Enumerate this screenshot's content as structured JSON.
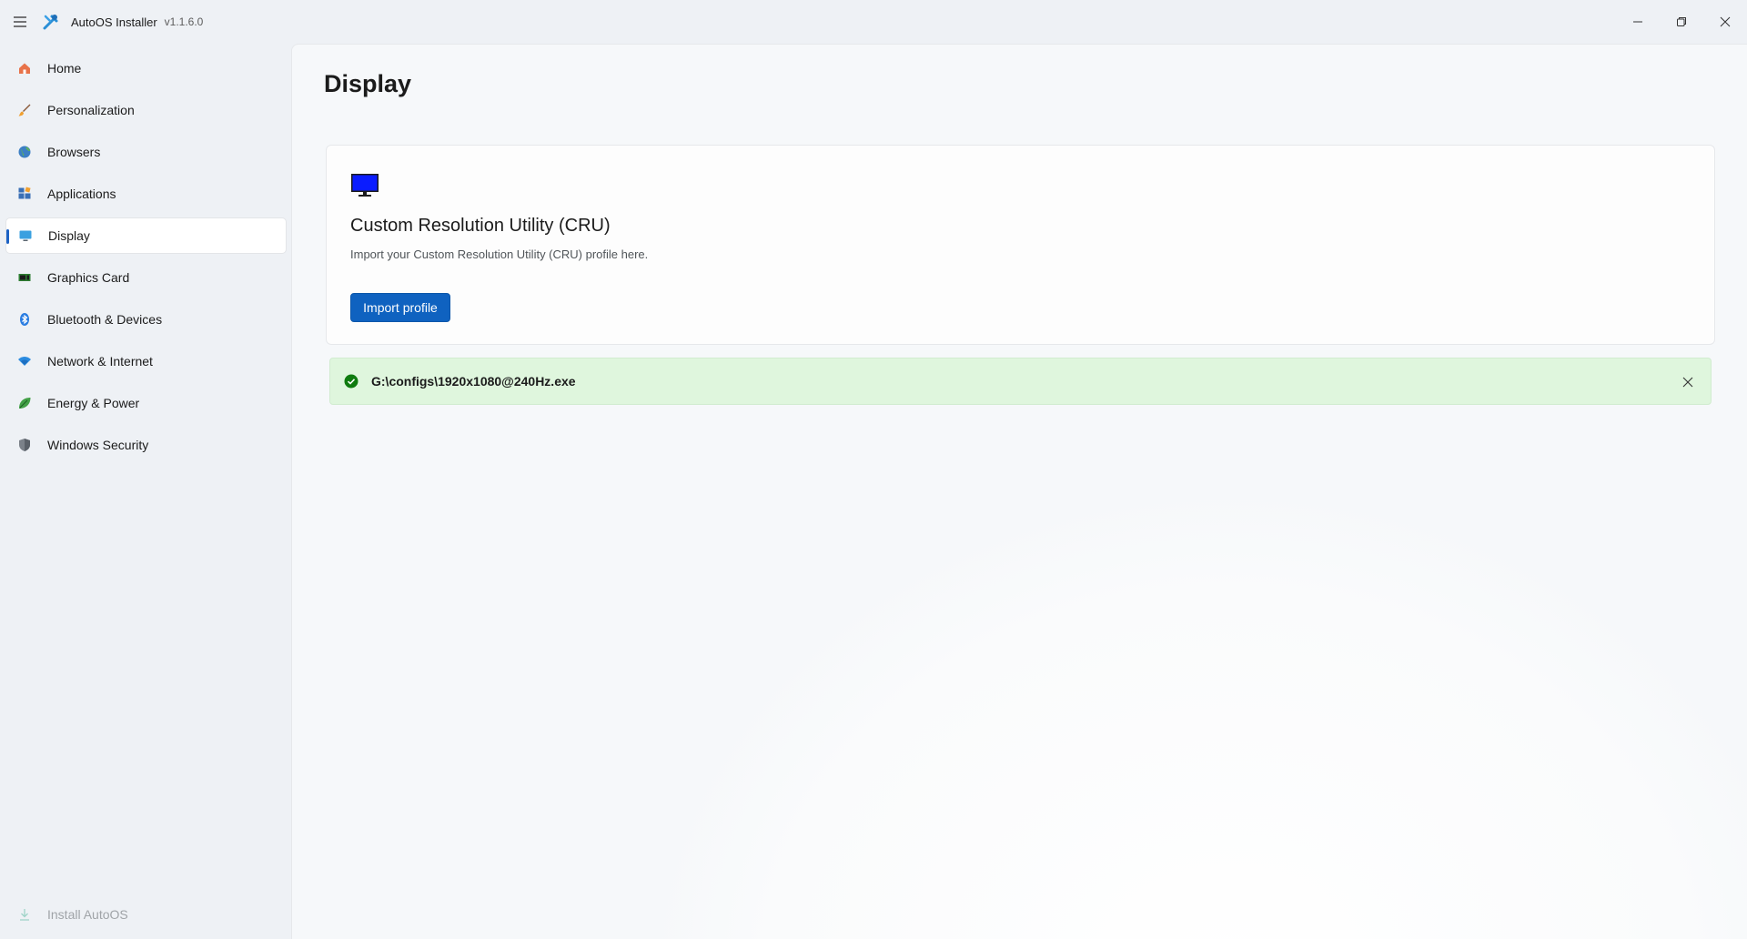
{
  "window": {
    "title": "AutoOS Installer",
    "version": "v1.1.6.0"
  },
  "sidebar": {
    "items": [
      {
        "label": "Home",
        "icon": "home-icon"
      },
      {
        "label": "Personalization",
        "icon": "brush-icon"
      },
      {
        "label": "Browsers",
        "icon": "globe-icon"
      },
      {
        "label": "Applications",
        "icon": "apps-icon"
      },
      {
        "label": "Display",
        "icon": "display-icon",
        "selected": true
      },
      {
        "label": "Graphics Card",
        "icon": "gpu-icon"
      },
      {
        "label": "Bluetooth & Devices",
        "icon": "bluetooth-icon"
      },
      {
        "label": "Network & Internet",
        "icon": "wifi-icon"
      },
      {
        "label": "Energy & Power",
        "icon": "leaf-icon"
      },
      {
        "label": "Windows Security",
        "icon": "shield-icon"
      }
    ],
    "footer": {
      "label": "Install AutoOS",
      "icon": "download-icon",
      "disabled": true
    }
  },
  "page": {
    "title": "Display",
    "card": {
      "title": "Custom Resolution Utility (CRU)",
      "description": "Import your Custom Resolution Utility (CRU) profile here.",
      "button_label": "Import profile"
    },
    "infobar": {
      "message": "G:\\configs\\1920x1080@240Hz.exe",
      "status": "success"
    }
  },
  "colors": {
    "accent": "#0f62c0",
    "success_bg": "#dff6dd",
    "success_icon": "#0f7b0f"
  }
}
